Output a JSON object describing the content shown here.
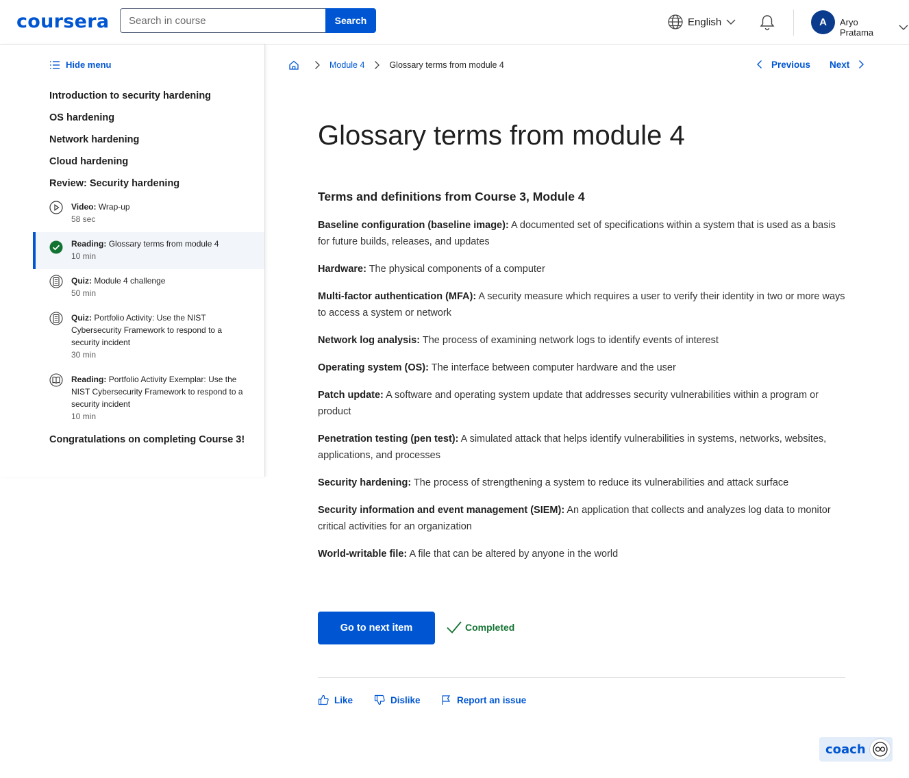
{
  "header": {
    "logo": "coursera",
    "search_placeholder": "Search in course",
    "search_button": "Search",
    "language": "English",
    "avatar_initial": "A",
    "user_name": "Aryo Pratama"
  },
  "sidebar": {
    "hide_menu": "Hide menu",
    "sections_top": [
      "Introduction to security hardening",
      "OS hardening",
      "Network hardening",
      "Cloud hardening",
      "Review: Security hardening"
    ],
    "items": [
      {
        "type": "Video:",
        "title": "Wrap-up",
        "duration": "58 sec",
        "icon": "play-circle-icon"
      },
      {
        "type": "Reading:",
        "title": "Glossary terms from module 4",
        "duration": "10 min",
        "icon": "completed-check-icon"
      },
      {
        "type": "Quiz:",
        "title": "Module 4 challenge",
        "duration": "50 min",
        "icon": "quiz-icon"
      },
      {
        "type": "Quiz:",
        "title": "Portfolio Activity: Use the NIST Cybersecurity Framework to respond to a security incident",
        "duration": "30 min",
        "icon": "quiz-icon"
      },
      {
        "type": "Reading:",
        "title": "Portfolio Activity Exemplar: Use the NIST Cybersecurity Framework to respond to a security incident",
        "duration": "10 min",
        "icon": "book-icon"
      }
    ],
    "section_bottom": "Congratulations on completing Course 3!"
  },
  "breadcrumb": {
    "module": "Module 4",
    "current": "Glossary terms from module 4"
  },
  "nav": {
    "previous": "Previous",
    "next": "Next"
  },
  "content": {
    "title": "Glossary terms from module 4",
    "subtitle": "Terms and definitions from Course 3, Module 4",
    "terms": [
      {
        "term": "Baseline configuration (baseline image):",
        "def": "A documented set of specifications within a system that is used as a basis for future builds, releases, and updates"
      },
      {
        "term": "Hardware:",
        "def": "The physical components of a computer"
      },
      {
        "term": "Multi-factor authentication (MFA):",
        "def": "A security measure which requires a user to verify their identity in two or more ways to access a system or network"
      },
      {
        "term": "Network log analysis:",
        "def": "The process of examining network logs to identify events of interest"
      },
      {
        "term": "Operating system (OS):",
        "def": "The interface between computer hardware and the user"
      },
      {
        "term": "Patch update:",
        "def": "A software and operating system update that addresses security vulnerabilities within a program or product"
      },
      {
        "term": "Penetration testing (pen test):",
        "def": "A simulated attack that helps identify vulnerabilities in systems, networks, websites, applications, and processes"
      },
      {
        "term": "Security hardening:",
        "def": "The process of strengthening a system to reduce its vulnerabilities and attack surface"
      },
      {
        "term": "Security information and event management (SIEM):",
        "def": "An application that collects and analyzes log data to monitor critical activities for an organization"
      },
      {
        "term": "World-writable file:",
        "def": "A file that can be altered by anyone in the world"
      }
    ]
  },
  "actions": {
    "next_item": "Go to next item",
    "completed": "Completed",
    "like": "Like",
    "dislike": "Dislike",
    "report": "Report an issue"
  },
  "coach": {
    "label": "coach"
  },
  "colors": {
    "brand": "#0056d2",
    "success": "#137333",
    "active_bg": "#f2f5fa"
  }
}
